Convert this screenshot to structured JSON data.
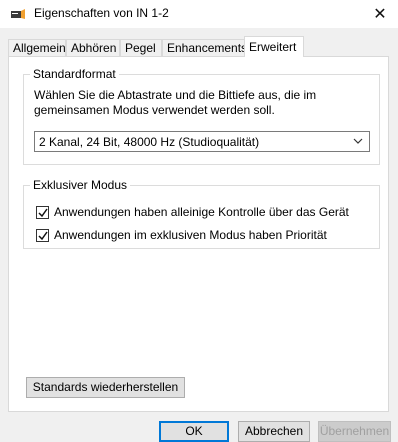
{
  "window": {
    "title": "Eigenschaften von IN 1-2",
    "close_glyph": "✕",
    "icon": "speaker-icon"
  },
  "tabs": [
    {
      "label": "Allgemein"
    },
    {
      "label": "Abhören"
    },
    {
      "label": "Pegel"
    },
    {
      "label": "Enhancements"
    },
    {
      "label": "Erweitert"
    }
  ],
  "standardformat": {
    "legend": "Standardformat",
    "description_line1": "Wählen Sie die Abtastrate und die Bittiefe aus, die im",
    "description_line2": "gemeinsamen Modus verwendet werden soll.",
    "selected": "2 Kanal, 24 Bit, 48000 Hz (Studioqualität)"
  },
  "exclusive": {
    "legend": "Exklusiver Modus",
    "options": [
      {
        "label": "Anwendungen haben alleinige Kontrolle über das Gerät",
        "checked": true
      },
      {
        "label": "Anwendungen im exklusiven Modus haben Priorität",
        "checked": true
      }
    ]
  },
  "buttons": {
    "restore": "Standards wiederherstellen",
    "ok": "OK",
    "cancel": "Abbrechen",
    "apply": "Übernehmen"
  },
  "colors": {
    "accent": "#0078d7",
    "window_bg": "#f0f0f0",
    "panel_bg": "#ffffff"
  }
}
